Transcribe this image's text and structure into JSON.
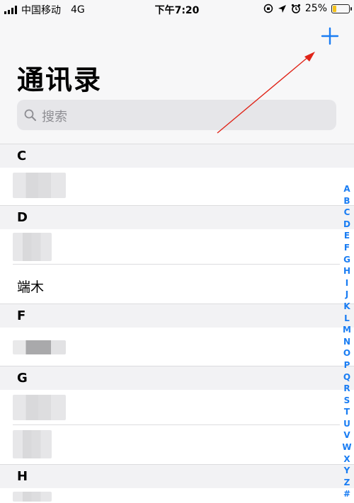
{
  "status_bar": {
    "carrier": "中国移动",
    "network": "4G",
    "time": "下午7:20",
    "battery": "25%",
    "battery_fraction": 0.25,
    "battery_color": "#f4c21a"
  },
  "header": {
    "title": "通讯录",
    "add_icon": "plus-icon",
    "accent_color": "#1a7df3"
  },
  "search": {
    "placeholder": "搜索",
    "icon": "search-icon"
  },
  "sections": [
    {
      "letter": "C",
      "rows": [
        {
          "name": ""
        }
      ]
    },
    {
      "letter": "D",
      "rows": [
        {
          "name": ""
        },
        {
          "name": "端木"
        }
      ]
    },
    {
      "letter": "F",
      "rows": [
        {
          "name": ""
        }
      ]
    },
    {
      "letter": "G",
      "rows": [
        {
          "name": ""
        },
        {
          "name": ""
        }
      ]
    },
    {
      "letter": "H",
      "rows": [
        {
          "name": ""
        }
      ]
    }
  ],
  "index_letters": [
    "A",
    "B",
    "C",
    "D",
    "E",
    "F",
    "G",
    "H",
    "I",
    "J",
    "K",
    "L",
    "M",
    "N",
    "O",
    "P",
    "Q",
    "R",
    "S",
    "T",
    "U",
    "V",
    "W",
    "X",
    "Y",
    "Z",
    "#"
  ]
}
